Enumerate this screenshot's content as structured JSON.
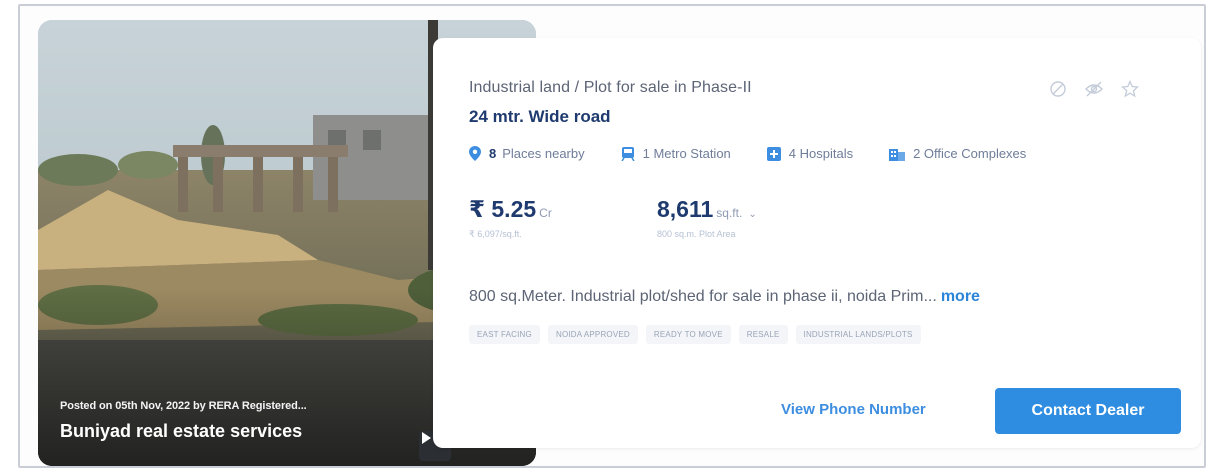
{
  "listing": {
    "title": "Industrial land / Plot for sale in Phase-II",
    "subtitle": "24 mtr. Wide road",
    "photo": {
      "posted": "Posted on 05th Nov, 2022 by RERA Registered...",
      "dealer": "Buniyad real estate services",
      "play_icon": "play-icon"
    },
    "actions": {
      "icons": [
        "reject-icon",
        "hide-icon",
        "star-icon"
      ],
      "view_phone": "View Phone Number",
      "contact": "Contact Dealer"
    },
    "nearby": {
      "count": "8",
      "label": "Places nearby",
      "items": [
        {
          "label": "1 Metro Station",
          "icon": "metro-icon"
        },
        {
          "label": "4 Hospitals",
          "icon": "hospital-icon"
        },
        {
          "label": "2 Office Complexes",
          "icon": "office-icon"
        }
      ]
    },
    "price": {
      "value": "₹ 5.25",
      "unit": "Cr",
      "per_unit": "₹ 6,097/sq.ft."
    },
    "area": {
      "value": "8,611",
      "unit": "sq.ft.",
      "sub": "800 sq.m. Plot Area"
    },
    "description": "800 sq.Meter. Industrial plot/shed for sale in phase ii, noida Prim...",
    "more": "more",
    "tags": [
      "EAST FACING",
      "NOIDA APPROVED",
      "READY TO MOVE",
      "RESALE",
      "INDUSTRIAL LANDS/PLOTS"
    ]
  },
  "colors": {
    "accent": "#2e8de0",
    "navy": "#1f3a6e",
    "muted": "#6f7d99"
  }
}
